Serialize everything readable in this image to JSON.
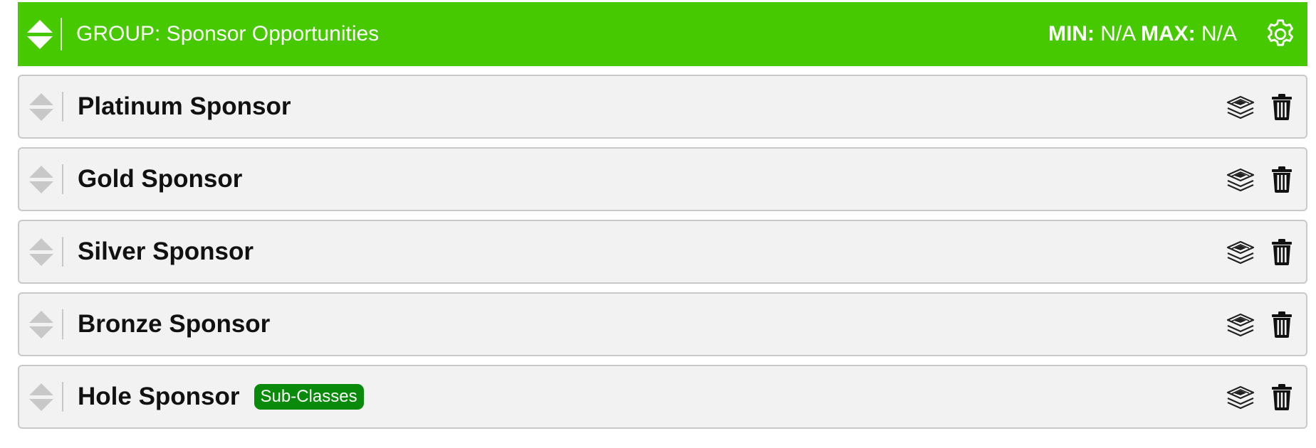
{
  "group": {
    "title": "GROUP: Sponsor Opportunities",
    "min_label": "MIN:",
    "min_value": "N/A",
    "max_label": "MAX:",
    "max_value": "N/A",
    "header_color": "#47c900",
    "settings_icon": "gear-icon",
    "handle_icon": "sort-arrows-icon"
  },
  "items": [
    {
      "label": "Platinum Sponsor",
      "badge": ""
    },
    {
      "label": "Gold Sponsor",
      "badge": ""
    },
    {
      "label": "Silver Sponsor",
      "badge": ""
    },
    {
      "label": "Bronze Sponsor",
      "badge": ""
    },
    {
      "label": "Hole Sponsor",
      "badge": "Sub-Classes"
    }
  ],
  "item_icons": {
    "copy": "layers-icon",
    "delete": "trash-icon"
  },
  "badge_color": "#0a8a0a"
}
